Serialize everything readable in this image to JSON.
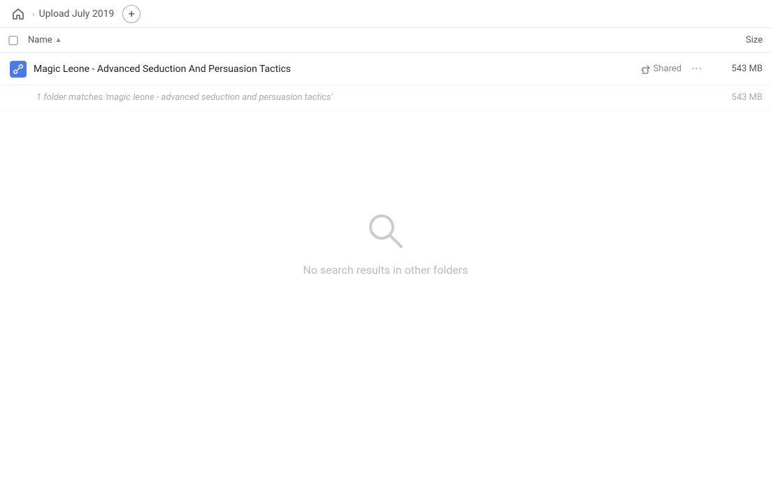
{
  "header": {
    "home_icon": "home",
    "breadcrumb_label": "Upload July 2019",
    "add_btn_label": "+"
  },
  "columns": {
    "name_label": "Name",
    "sort_icon": "▲",
    "size_label": "Size"
  },
  "file_row": {
    "icon_char": "🔗",
    "title": "Magic Leone - Advanced Seduction And Persuasion Tactics",
    "shared_label": "Shared",
    "more_label": "···",
    "size": "543 MB"
  },
  "submatch": {
    "text": "1 folder matches 'magic leone - advanced seduction and persuasion tactics'",
    "size": "543 MB"
  },
  "empty_state": {
    "message": "No search results in other folders"
  }
}
